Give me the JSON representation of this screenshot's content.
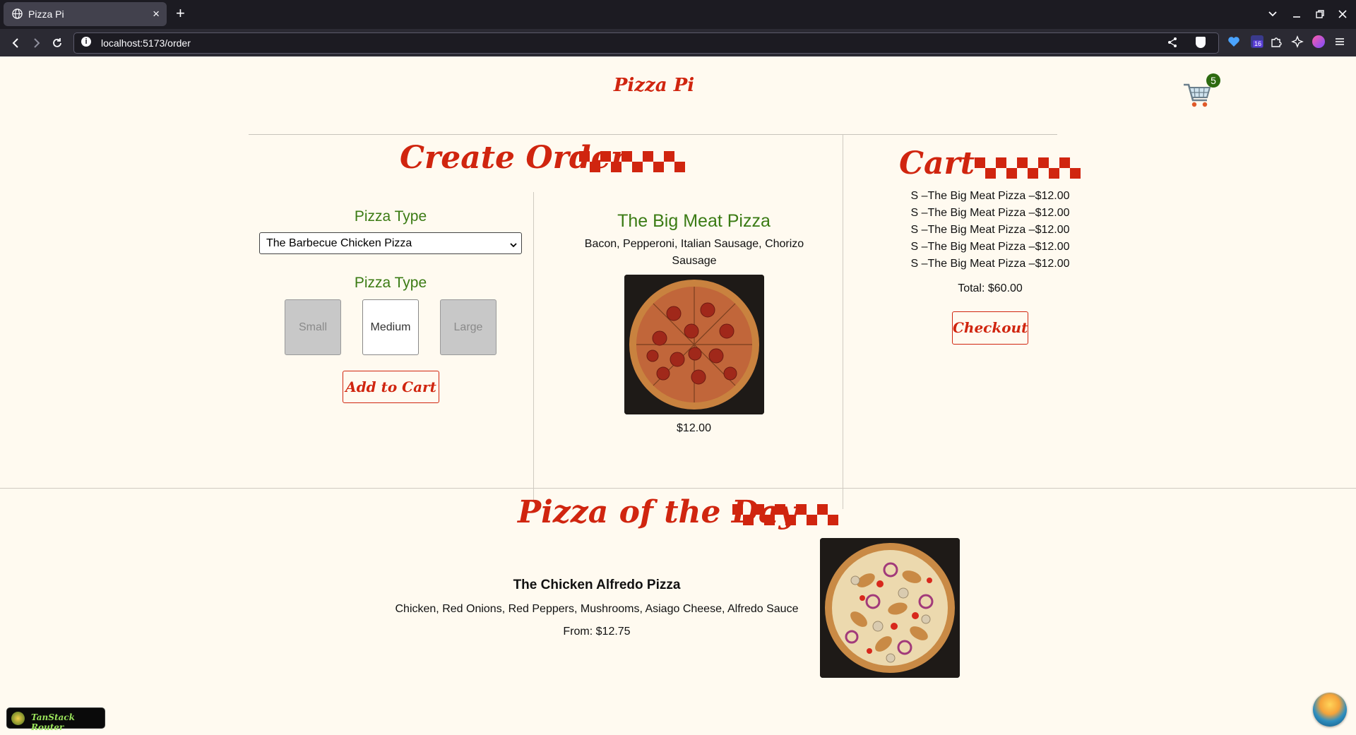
{
  "browser": {
    "tab_title": "Pizza Pi",
    "tab_close": "×",
    "new_tab": "+",
    "url": "localhost:5173/order",
    "extension_badge": "16"
  },
  "header": {
    "logo": "Pizza Pi",
    "cart_count": "5"
  },
  "order": {
    "title": "Create Order",
    "pizza_type_label": "Pizza Type",
    "selected_pizza": "The Barbecue Chicken Pizza",
    "size_label": "Pizza Type",
    "sizes": [
      {
        "label": "Small",
        "state": "disabled"
      },
      {
        "label": "Medium",
        "state": "selected"
      },
      {
        "label": "Large",
        "state": "disabled"
      }
    ],
    "add_button": "Add to Cart"
  },
  "preview": {
    "name": "The Big Meat Pizza",
    "ingredients": "Bacon, Pepperoni, Italian Sausage, Chorizo Sausage",
    "price": "$12.00"
  },
  "cart": {
    "title": "Cart",
    "items": [
      "S –The Big Meat Pizza –$12.00",
      "S –The Big Meat Pizza –$12.00",
      "S –The Big Meat Pizza –$12.00",
      "S –The Big Meat Pizza –$12.00",
      "S –The Big Meat Pizza –$12.00"
    ],
    "total": "Total: $60.00",
    "checkout_button": "Checkout"
  },
  "pizza_of_the_day": {
    "title": "Pizza of the Day",
    "name": "The Chicken Alfredo Pizza",
    "ingredients": "Chicken, Red Onions, Red Peppers, Mushrooms, Asiago Cheese, Alfredo Sauce",
    "price": "From: $12.75"
  },
  "devtools": {
    "label": "TanStack Router"
  },
  "colors": {
    "brand_red": "#d0250f",
    "label_green": "#3b7b14",
    "background": "#fffaf0",
    "badge_green": "#2d6a10"
  }
}
